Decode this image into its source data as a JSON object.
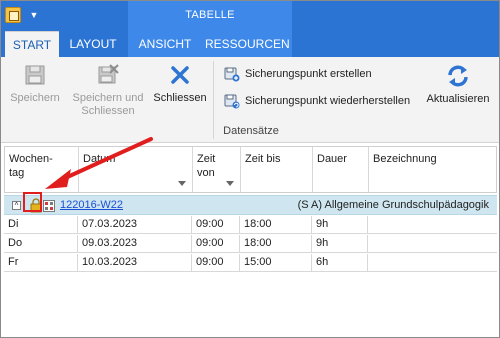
{
  "context_header": "TABELLE",
  "tabs": [
    {
      "label": "START",
      "active": true
    },
    {
      "label": "LAYOUT",
      "active": false
    },
    {
      "label": "ANSICHT",
      "active": false
    },
    {
      "label": "RESSOURCEN",
      "active": false
    }
  ],
  "ribbon": {
    "save": {
      "label": "Speichern",
      "enabled": false,
      "icon": "floppy-disk-icon"
    },
    "save_close": {
      "label_line1": "Speichern und",
      "label_line2": "Schliessen",
      "enabled": false,
      "icon": "floppy-close-icon"
    },
    "close": {
      "label": "Schliessen",
      "enabled": true,
      "icon": "close-x-icon"
    },
    "create_backup": {
      "label": "Sicherungspunkt erstellen",
      "icon": "backup-create-icon"
    },
    "restore_backup": {
      "label": "Sicherungspunkt wiederherstellen",
      "icon": "backup-restore-icon"
    },
    "refresh": {
      "label": "Aktualisieren",
      "icon": "refresh-icon"
    },
    "group_label": "Datensätze"
  },
  "grid": {
    "columns": [
      {
        "line1": "Wochen-",
        "line2": "tag",
        "sortable": false
      },
      {
        "line1": "Datum",
        "line2": "",
        "sortable": true
      },
      {
        "line1": "Zeit",
        "line2": "von",
        "sortable": true
      },
      {
        "line1": "Zeit bis",
        "line2": "",
        "sortable": false
      },
      {
        "line1": "Dauer",
        "line2": "",
        "sortable": false
      },
      {
        "line1": "Bezeichnung",
        "line2": "",
        "sortable": false
      }
    ],
    "group": {
      "expander": "^",
      "link": "122016-W22",
      "description": "(S A) Allgemeine Grundschulpädagogik"
    },
    "rows": [
      [
        "Di",
        "07.03.2023",
        "09:00",
        "18:00",
        "9h",
        ""
      ],
      [
        "Do",
        "09.03.2023",
        "09:00",
        "18:00",
        "9h",
        ""
      ],
      [
        "Fr",
        "10.03.2023",
        "09:00",
        "15:00",
        "6h",
        ""
      ]
    ]
  },
  "colors": {
    "titlebar": "#2b74d4",
    "context_band": "#3d88e8",
    "group_row": "#cfe6f0",
    "annotation": "#e01e1e",
    "link": "#1a4fd6"
  }
}
